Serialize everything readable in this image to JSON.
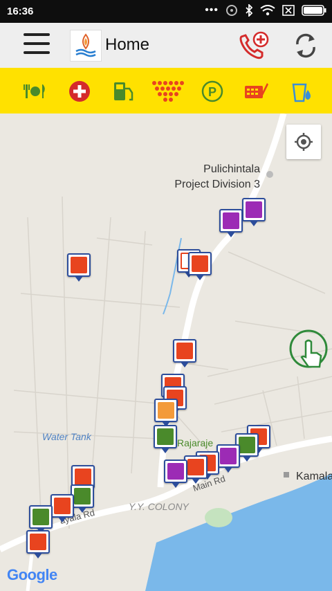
{
  "status": {
    "time": "16:36"
  },
  "appbar": {
    "title": "Home"
  },
  "categories": [
    "fork-knife-icon",
    "medical-cross-icon",
    "fuel-pump-icon",
    "dots-icon",
    "parking-icon",
    "atm-card-icon",
    "water-icon"
  ],
  "map": {
    "labels": {
      "pulichintala": "Pulichintala\nProject Division 3",
      "water_tank": "Water Tank",
      "rajaraje": "Rajaraje",
      "main_rd": "Main Rd",
      "yy_colony": "Y.Y. COLONY",
      "kamala": "Kamala",
      "ayala_rd": "ayala Rd"
    },
    "google": "Google"
  },
  "colors": {
    "accent_yellow": "#ffe100",
    "brand_red": "#d42b2b",
    "pin_blue": "#2c4d9b",
    "map_bg": "#ebe8e1",
    "water": "#7ab8ea"
  }
}
